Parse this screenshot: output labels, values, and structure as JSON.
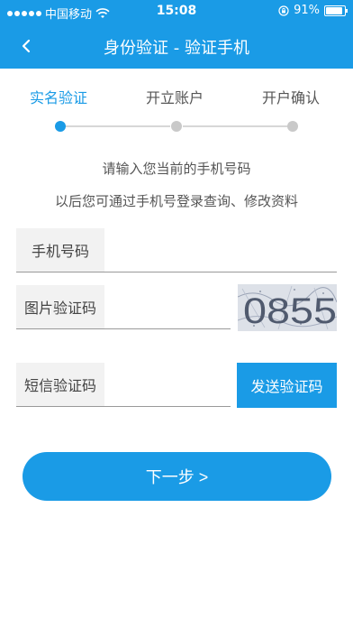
{
  "status_bar": {
    "carrier": "中国移动",
    "time": "15:08",
    "battery": "91%",
    "battery_level": 0.91,
    "signal_icon": "signal-dots-icon",
    "wifi_icon": "wifi-icon",
    "lock_icon": "rotation-lock-icon"
  },
  "nav": {
    "title": "身份验证 - 验证手机",
    "back_icon": "chevron-left-icon"
  },
  "steps": [
    {
      "label": "实名验证",
      "active": true
    },
    {
      "label": "开立账户",
      "active": false
    },
    {
      "label": "开户确认",
      "active": false
    }
  ],
  "info": {
    "line1": "请输入您当前的手机号码",
    "line2": "以后您可通过手机号登录查询、修改资料"
  },
  "form": {
    "phone_label": "手机号码",
    "phone_value": "",
    "captcha_label": "图片验证码",
    "captcha_value": "",
    "captcha_text": "0855",
    "sms_label": "短信验证码",
    "sms_value": "",
    "send_button": "发送验证码"
  },
  "next_button": "下一步 >",
  "colors": {
    "primary": "#1a9be6",
    "inactive_step": "#c9c9c9",
    "label_bg": "#f2f2f2"
  }
}
